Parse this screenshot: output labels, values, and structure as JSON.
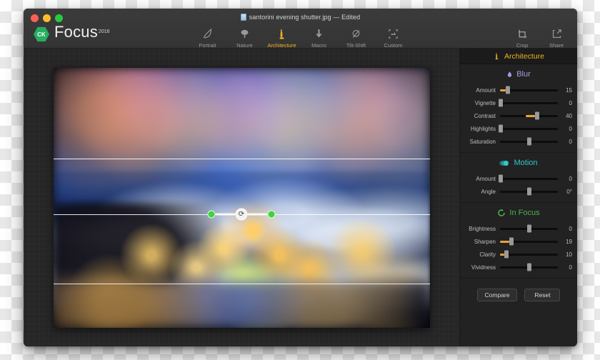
{
  "window": {
    "title": "santorini evening shutter.jpg — Edited",
    "doc_icon": "document-icon",
    "traffic": {
      "close": "close-button",
      "minimize": "minimize-button",
      "maximize": "maximize-button"
    }
  },
  "brand": {
    "badge_text": "CK",
    "name": "Focus",
    "year": "2016"
  },
  "presets": [
    {
      "label": "Portrait",
      "icon": "portrait-icon",
      "active": false
    },
    {
      "label": "Nature",
      "icon": "tree-icon",
      "active": false
    },
    {
      "label": "Architecture",
      "icon": "building-icon",
      "active": true
    },
    {
      "label": "Macro",
      "icon": "macro-icon",
      "active": false
    },
    {
      "label": "Tilt-Shift",
      "icon": "tiltshift-icon",
      "active": false
    },
    {
      "label": "Custom",
      "icon": "custom-icon",
      "active": false
    }
  ],
  "right_tools": [
    {
      "label": "Crop",
      "icon": "crop-icon"
    },
    {
      "label": "Share",
      "icon": "share-icon"
    }
  ],
  "canvas": {
    "tilt_handle": {
      "icon": "rotate-icon",
      "left_dot": "handle-dot-left",
      "right_dot": "handle-dot-right"
    }
  },
  "sidebar": {
    "header": {
      "label": "Architecture",
      "icon": "building-icon"
    },
    "sections": [
      {
        "title": "Blur",
        "icon": "droplet-icon",
        "color": "#a99ae0",
        "sliders": [
          {
            "label": "Amount",
            "value": "15",
            "pos": 13,
            "fill_from": 0,
            "fill": true
          },
          {
            "label": "Vignette",
            "value": "0",
            "pos": 1,
            "fill_from": 0,
            "fill": false
          },
          {
            "label": "Contrast",
            "value": "40",
            "pos": 64,
            "fill_from": 44,
            "fill": true
          },
          {
            "label": "Highlights",
            "value": "0",
            "pos": 1,
            "fill_from": 0,
            "fill": false
          },
          {
            "label": "Saturation",
            "value": "0",
            "pos": 50,
            "fill_from": 50,
            "fill": false
          }
        ]
      },
      {
        "title": "Motion",
        "icon": "motion-icon",
        "color": "#2ec7c7",
        "sliders": [
          {
            "label": "Amount",
            "value": "0",
            "pos": 1,
            "fill_from": 0,
            "fill": false
          },
          {
            "label": "Angle",
            "value": "0°",
            "pos": 50,
            "fill_from": 50,
            "fill": false
          }
        ]
      },
      {
        "title": "In Focus",
        "icon": "focus-icon",
        "color": "#4fb152",
        "sliders": [
          {
            "label": "Brightness",
            "value": "0",
            "pos": 50,
            "fill_from": 50,
            "fill": false
          },
          {
            "label": "Sharpen",
            "value": "19",
            "pos": 20,
            "fill_from": 0,
            "fill": true
          },
          {
            "label": "Clarity",
            "value": "10",
            "pos": 11,
            "fill_from": 0,
            "fill": true
          },
          {
            "label": "Vividness",
            "value": "0",
            "pos": 50,
            "fill_from": 50,
            "fill": false
          }
        ]
      }
    ],
    "buttons": [
      {
        "label": "Compare",
        "name": "compare-button"
      },
      {
        "label": "Reset",
        "name": "reset-button"
      }
    ]
  },
  "colors": {
    "accent_active": "#f0b323",
    "slider_fill": "#e8a33d",
    "blur": "#a99ae0",
    "motion": "#2ec7c7",
    "focus": "#4fb152",
    "window_bg": "#2c2c2c",
    "sidebar_bg": "#222222"
  }
}
